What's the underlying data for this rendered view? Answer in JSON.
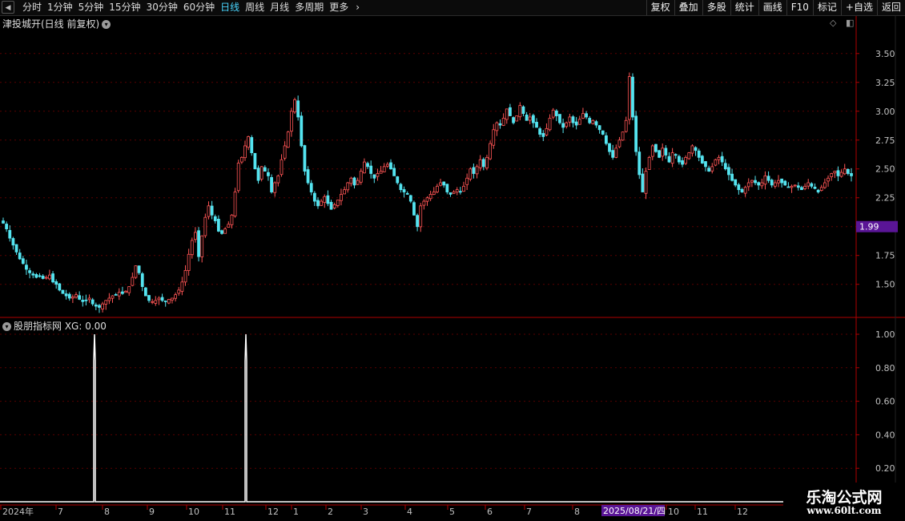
{
  "toolbar": {
    "tabs": [
      "分时",
      "1分钟",
      "5分钟",
      "15分钟",
      "30分钟",
      "60分钟",
      "日线",
      "周线",
      "月线",
      "多周期",
      "更多"
    ],
    "active_tab": "日线",
    "right_buttons": [
      "复权",
      "叠加",
      "多股",
      "统计",
      "画线",
      "F10",
      "标记",
      "+自选",
      "返回"
    ]
  },
  "main_chart": {
    "title": "津投城开(日线 前复权)",
    "price_tag": "1.99",
    "y_ticks": [
      "3.50",
      "3.25",
      "3.00",
      "2.75",
      "2.50",
      "2.25",
      "2.00",
      "1.75",
      "1.50"
    ]
  },
  "indicator": {
    "title": "股朋指标网 XG: 0.00",
    "y_ticks": [
      "1.00",
      "0.80",
      "0.60",
      "0.40",
      "0.20"
    ]
  },
  "time_axis": {
    "labels": [
      "2024年",
      "7",
      "8",
      "9",
      "10",
      "11",
      "12",
      "1",
      "2",
      "3",
      "4",
      "5",
      "6",
      "7",
      "8",
      "10",
      "11",
      "12"
    ],
    "cursor_label": "2025/08/21/四"
  },
  "watermark": {
    "line1": "乐淘公式网",
    "line2": "www.60lt.com"
  },
  "colors": {
    "up": "#ff5555",
    "down": "#54e4f0",
    "signal": "#ffffff",
    "axis": "#b00000",
    "grid": "#5a0000",
    "cursor_bg": "#5a1596"
  },
  "chart_data": [
    {
      "type": "candlestick",
      "title": "津投城开(日线 前复权)",
      "ylim": [
        1.22,
        3.7
      ],
      "close_series": [
        2.03,
        1.98,
        1.9,
        1.84,
        1.78,
        1.72,
        1.68,
        1.63,
        1.6,
        1.58,
        1.56,
        1.57,
        1.55,
        1.56,
        1.58,
        1.52,
        1.5,
        1.45,
        1.42,
        1.4,
        1.38,
        1.39,
        1.41,
        1.37,
        1.35,
        1.36,
        1.38,
        1.33,
        1.31,
        1.3,
        1.33,
        1.36,
        1.38,
        1.4,
        1.41,
        1.43,
        1.42,
        1.44,
        1.48,
        1.56,
        1.66,
        1.6,
        1.48,
        1.4,
        1.36,
        1.35,
        1.36,
        1.38,
        1.36,
        1.35,
        1.37,
        1.38,
        1.41,
        1.45,
        1.52,
        1.62,
        1.76,
        1.88,
        1.95,
        1.74,
        1.92,
        2.08,
        2.18,
        2.1,
        2.05,
        1.96,
        1.94,
        1.98,
        2.02,
        2.1,
        2.3,
        2.55,
        2.6,
        2.7,
        2.78,
        2.64,
        2.5,
        2.4,
        2.52,
        2.48,
        2.44,
        2.3,
        2.38,
        2.44,
        2.58,
        2.7,
        2.82,
        3.0,
        3.1,
        2.95,
        2.7,
        2.48,
        2.38,
        2.3,
        2.22,
        2.18,
        2.22,
        2.26,
        2.2,
        2.15,
        2.19,
        2.23,
        2.28,
        2.32,
        2.38,
        2.42,
        2.36,
        2.4,
        2.48,
        2.56,
        2.52,
        2.46,
        2.42,
        2.46,
        2.48,
        2.52,
        2.54,
        2.5,
        2.44,
        2.38,
        2.32,
        2.3,
        2.28,
        2.22,
        2.1,
        2.0,
        2.18,
        2.22,
        2.25,
        2.28,
        2.3,
        2.35,
        2.38,
        2.36,
        2.3,
        2.28,
        2.3,
        2.32,
        2.3,
        2.35,
        2.42,
        2.5,
        2.46,
        2.52,
        2.58,
        2.52,
        2.6,
        2.72,
        2.84,
        2.9,
        2.88,
        2.94,
        3.02,
        2.96,
        2.9,
        2.96,
        3.05,
        2.98,
        2.92,
        2.95,
        2.9,
        2.86,
        2.8,
        2.78,
        2.85,
        2.94,
        3.01,
        2.96,
        2.9,
        2.86,
        2.9,
        2.95,
        2.9,
        2.88,
        2.93,
        2.98,
        2.95,
        2.9,
        2.92,
        2.88,
        2.84,
        2.8,
        2.72,
        2.65,
        2.6,
        2.68,
        2.75,
        2.82,
        2.92,
        3.3,
        2.95,
        2.65,
        2.45,
        2.3,
        2.48,
        2.6,
        2.7,
        2.65,
        2.6,
        2.68,
        2.62,
        2.56,
        2.64,
        2.62,
        2.56,
        2.54,
        2.6,
        2.64,
        2.7,
        2.66,
        2.6,
        2.55,
        2.52,
        2.48,
        2.52,
        2.58,
        2.6,
        2.56,
        2.5,
        2.45,
        2.4,
        2.36,
        2.32,
        2.3,
        2.34,
        2.38,
        2.4,
        2.38,
        2.36,
        2.38,
        2.44,
        2.4,
        2.36,
        2.38,
        2.4,
        2.38,
        2.36,
        2.34,
        2.35,
        2.36,
        2.34,
        2.32,
        2.35,
        2.38,
        2.35,
        2.33,
        2.3,
        2.34,
        2.38,
        2.42,
        2.46,
        2.48,
        2.44,
        2.47,
        2.5,
        2.46,
        2.44
      ]
    },
    {
      "type": "line",
      "title": "股朋指标网 XG: 0.00",
      "ylim": [
        0,
        1.0
      ],
      "spike_dates": [
        "2024-07-29",
        "2024-11-18"
      ],
      "values_note_spikes": [
        1.0,
        1.0
      ]
    }
  ]
}
